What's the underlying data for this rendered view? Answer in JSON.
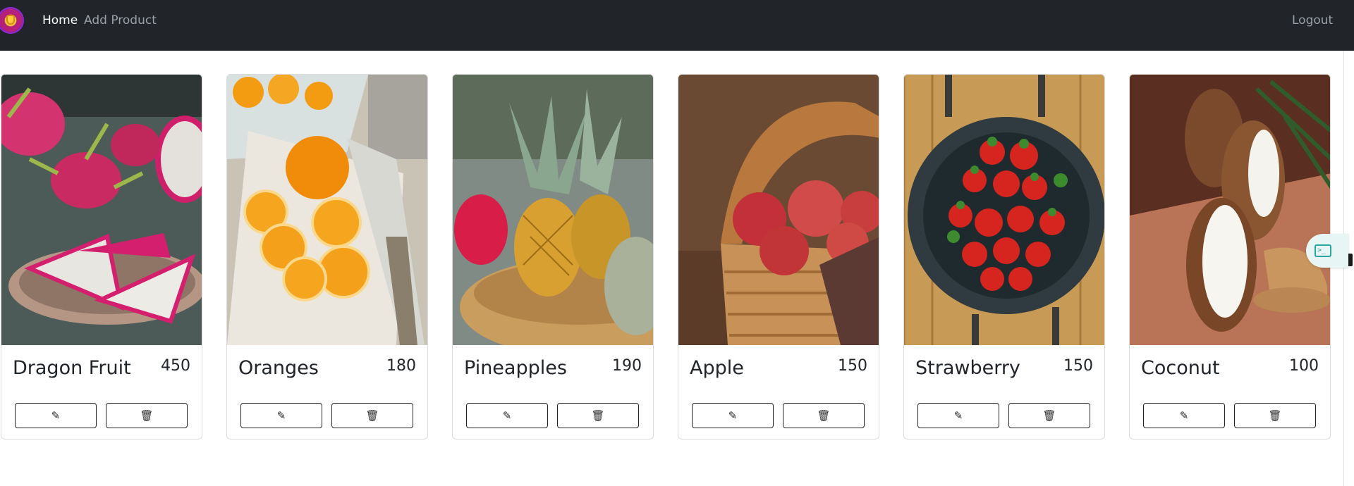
{
  "nav": {
    "home_label": "Home",
    "add_product_label": "Add Product",
    "logout_label": "Logout",
    "brand_icon": "brand-logo-icon"
  },
  "icons": {
    "edit": "pencil-icon",
    "delete": "trash-icon",
    "terminal": "terminal-icon"
  },
  "products": [
    {
      "name": "Dragon Fruit",
      "price": "450"
    },
    {
      "name": "Oranges",
      "price": "180"
    },
    {
      "name": "Pineapples",
      "price": "190"
    },
    {
      "name": "Apple",
      "price": "150"
    },
    {
      "name": "Strawberry",
      "price": "150"
    },
    {
      "name": "Coconut",
      "price": "100"
    }
  ],
  "colors": {
    "navbar_bg": "#212529",
    "nav_active": "#ffffff",
    "nav_muted": "#9ba0a6",
    "accent_teal": "#2aa6a0"
  }
}
